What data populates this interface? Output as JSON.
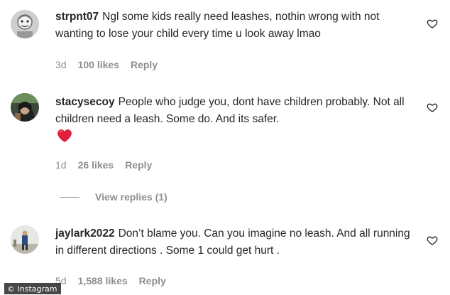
{
  "comments": [
    {
      "username": "strpnt07",
      "text": "Ngl some kids really need leashes, nothin wrong with not wanting to lose your child every time u look away lmao",
      "time": "3d",
      "likes": "100 likes",
      "reply": "Reply",
      "emoji": null
    },
    {
      "username": "stacysecoy",
      "text": "People who judge you, dont have children probably. Not all children need a leash. Some do. And its safer.",
      "time": "1d",
      "likes": "26 likes",
      "reply": "Reply",
      "emoji": "red-heart"
    },
    {
      "username": "jaylark2022",
      "text": "Don’t blame you. Can you imagine no leash. And all running in different directions . Some 1 could get hurt .",
      "time": "5d",
      "likes": "1,588 likes",
      "reply": "Reply",
      "emoji": null
    }
  ],
  "view_replies": "View replies (1)",
  "watermark": "© Instagram",
  "colors": {
    "text": "#262626",
    "meta": "#8e8e8e",
    "heart_emoji": "#e0203a"
  },
  "icons": {
    "like": "heart-outline-icon",
    "emoji": "red-heart-emoji"
  }
}
